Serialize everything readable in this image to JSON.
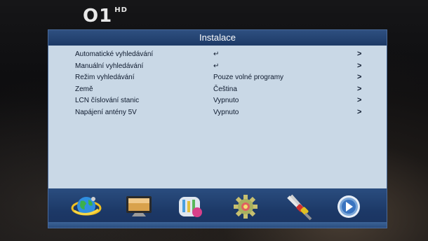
{
  "channel": {
    "logo_text": "O1",
    "hd_badge": "HD"
  },
  "menu": {
    "title": "Instalace",
    "items": [
      {
        "label": "Automatické vyhledávání",
        "value": "↵",
        "arrow": ">"
      },
      {
        "label": "Manuální vyhledávání",
        "value": "↵",
        "arrow": ">"
      },
      {
        "label": "Režim vyhledávání",
        "value": "Pouze volné programy",
        "arrow": ">"
      },
      {
        "label": "Země",
        "value": "Čeština",
        "arrow": ">"
      },
      {
        "label": "LCN číslování stanic",
        "value": "Vypnuto",
        "arrow": ">"
      },
      {
        "label": "Napájení antény 5V",
        "value": "Vypnuto",
        "arrow": ">"
      }
    ]
  },
  "icons": [
    {
      "name": "globe-satellite-icon"
    },
    {
      "name": "monitor-icon"
    },
    {
      "name": "settings-tools-icon"
    },
    {
      "name": "gear-icon"
    },
    {
      "name": "cables-icon"
    },
    {
      "name": "media-play-icon"
    }
  ],
  "colors": {
    "panel_bg": "#c9d8e6",
    "title_bar": "#1d3a66",
    "icon_bar": "#1c3866"
  }
}
